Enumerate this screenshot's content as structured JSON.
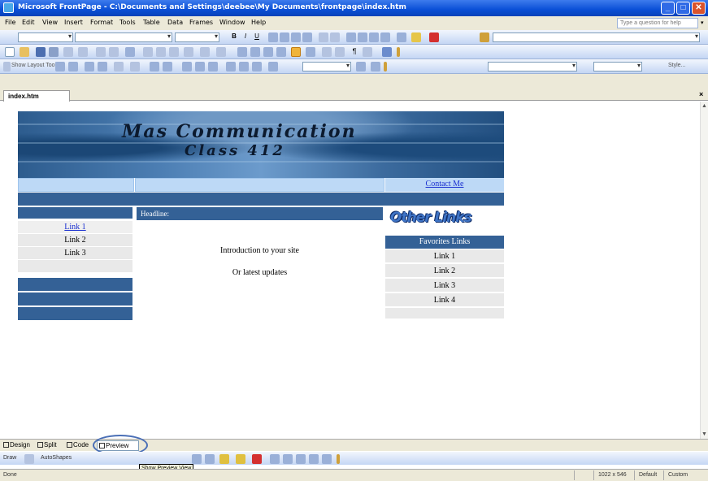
{
  "window": {
    "title": "Microsoft FrontPage - C:\\Documents and Settings\\deebee\\My Documents\\frontpage\\index.htm"
  },
  "menu": {
    "items": [
      "File",
      "Edit",
      "View",
      "Insert",
      "Format",
      "Tools",
      "Table",
      "Data",
      "Frames",
      "Window",
      "Help"
    ],
    "help_placeholder": "Type a question for help"
  },
  "toolbars": {
    "layout_tool_label": "Show Layout Tool",
    "style_label": "Style..."
  },
  "document_tab": {
    "label": "index.htm"
  },
  "page": {
    "banner_line1": "Mas Communication",
    "banner_line2": "Class 412",
    "contact_link": "Contact Me",
    "headline": "Headline:",
    "left_links": [
      "Link 1",
      "Link 2",
      "Link 3"
    ],
    "intro_text": "Introduction to your site",
    "updates_text": "Or latest updates",
    "other_links_graphic": "Other Links",
    "favorites_heading": "Favorites Links",
    "right_links": [
      "Link 1",
      "Link 2",
      "Link 3",
      "Link 4"
    ]
  },
  "view_tabs": {
    "design": "Design",
    "split": "Split",
    "code": "Code",
    "preview": "Preview",
    "tooltip": "Show Preview View"
  },
  "drawing_toolbar": {
    "draw": "Draw",
    "autoshapes": "AutoShapes"
  },
  "status": {
    "left": "Done",
    "size": "1022 x 546",
    "mode": "Default",
    "custom": "Custom"
  },
  "colors": {
    "titlebar": "#0a4fd6",
    "nav_dark": "#346196",
    "nav_light": "#bdd9f6",
    "link": "#1a2fd0"
  }
}
